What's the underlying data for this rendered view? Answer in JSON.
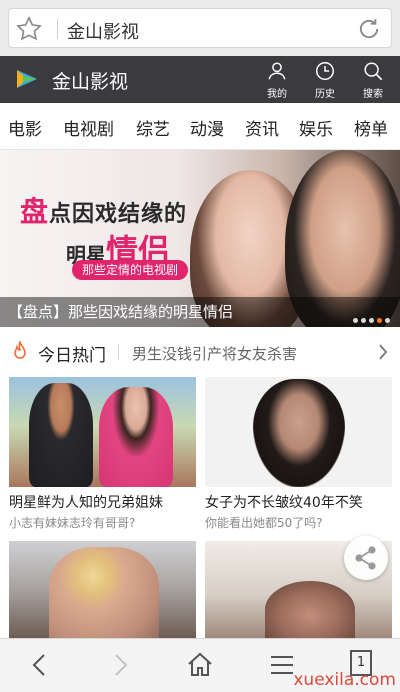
{
  "browser": {
    "address": "金山影视"
  },
  "site": {
    "title": "金山影视",
    "header_buttons": [
      {
        "label": "我的",
        "icon": "user-icon"
      },
      {
        "label": "历史",
        "icon": "clock-icon"
      },
      {
        "label": "搜索",
        "icon": "search-icon"
      }
    ]
  },
  "nav": {
    "categories": [
      "电影",
      "电视剧",
      "综艺",
      "动漫",
      "资讯",
      "娱乐",
      "榜单"
    ]
  },
  "banner": {
    "title_line1_mark": "盘",
    "title_line1_rest": "点因戏结缘的",
    "title_line2_prefix": "明星",
    "title_line2_emph": "情侣",
    "pill": "那些定情的电视剧",
    "caption": "【盘点】那些因戏结缘的明星情侣",
    "slide_count": 5,
    "active_slide": 4
  },
  "hot": {
    "label": "今日热门",
    "headline": "男生没钱引产将女友杀害"
  },
  "cards": [
    {
      "title": "明星鲜为人知的兄弟姐妹",
      "subtitle": "小志有妹妹志玲有哥哥?"
    },
    {
      "title": "女子为不长皱纹40年不笑",
      "subtitle": "你能看出她都50了吗?"
    },
    {
      "title": "",
      "subtitle": ""
    },
    {
      "title": "",
      "subtitle": ""
    }
  ],
  "toolbar": {
    "tab_count": "1"
  },
  "watermark": "xuexila.com",
  "colors": {
    "header_bg": "#3a3a3f",
    "accent_pink": "#e0256c",
    "active_dot": "#ff7a1a",
    "hot_icon": "#ff6a3a"
  }
}
